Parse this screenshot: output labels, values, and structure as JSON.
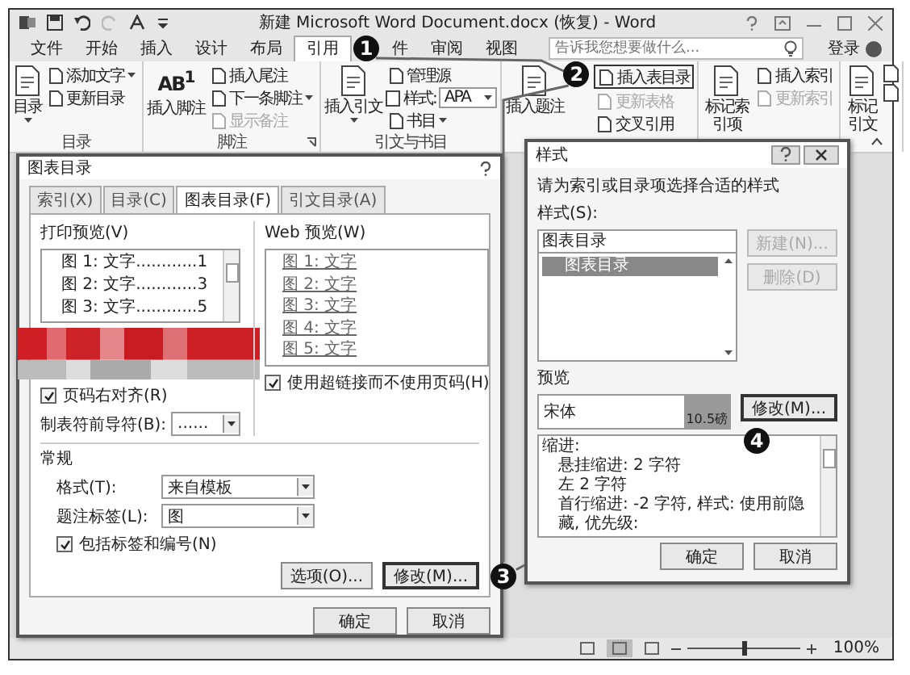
{
  "window": {
    "title": "新建 Microsoft Word Document.docx (恢复) - Word"
  },
  "menu_tabs": [
    {
      "label": "文件",
      "selected": false
    },
    {
      "label": "开始",
      "selected": false
    },
    {
      "label": "插入",
      "selected": false
    },
    {
      "label": "设计",
      "selected": false
    },
    {
      "label": "布局",
      "selected": false
    },
    {
      "label": "引用",
      "selected": true
    },
    {
      "label": "件",
      "selected": false
    },
    {
      "label": "审阅",
      "selected": false
    },
    {
      "label": "视图",
      "selected": false
    }
  ],
  "search": {
    "placeholder": "告诉我您想要做什么..."
  },
  "account": {
    "label": "登录"
  },
  "ribbon": [
    {
      "label": "目录",
      "launcher": false,
      "items": [
        {
          "kind": "large",
          "label": "目录",
          "dropdown": true,
          "disabled": false
        },
        {
          "kind": "small",
          "label": "添加文字",
          "dropdown": true,
          "disabled": false,
          "highlighted": false
        },
        {
          "kind": "small",
          "label": "更新目录",
          "dropdown": false,
          "disabled": false,
          "highlighted": false
        }
      ]
    },
    {
      "label": "脚注",
      "launcher": true,
      "items": [
        {
          "kind": "large",
          "label": "插入脚注",
          "icon_text": "AB$^{1}$",
          "dropdown": false,
          "disabled": false
        },
        {
          "kind": "small",
          "label": "插入尾注",
          "dropdown": false,
          "disabled": false,
          "highlighted": false
        },
        {
          "kind": "small",
          "label": "下一条脚注",
          "dropdown": true,
          "disabled": false,
          "highlighted": false
        },
        {
          "kind": "small",
          "label": "显示备注",
          "dropdown": false,
          "disabled": true,
          "highlighted": false
        }
      ]
    },
    {
      "label": "引文与书目",
      "launcher": false,
      "items": [
        {
          "kind": "large",
          "label": "插入引文",
          "dropdown": true,
          "disabled": false
        },
        {
          "kind": "small",
          "label": "管理源",
          "dropdown": false,
          "disabled": false,
          "highlighted": false
        },
        {
          "kind": "combo",
          "label": "样式:",
          "value": "APA"
        },
        {
          "kind": "small",
          "label": "书目",
          "dropdown": true,
          "disabled": false,
          "highlighted": false
        }
      ]
    },
    {
      "launcher": false,
      "items": [
        {
          "kind": "large",
          "label": "插入题注",
          "dropdown": false,
          "disabled": false
        },
        {
          "kind": "small",
          "label": "插入表目录",
          "dropdown": false,
          "disabled": false,
          "highlighted": true
        },
        {
          "kind": "small",
          "label": "更新表格",
          "dropdown": false,
          "disabled": true,
          "highlighted": false
        },
        {
          "kind": "small",
          "label": "交叉引用",
          "dropdown": false,
          "disabled": false,
          "highlighted": false
        }
      ]
    },
    {
      "launcher": false,
      "items": [
        {
          "kind": "large",
          "label": "标记索引项",
          "dropdown": false,
          "disabled": false
        },
        {
          "kind": "small",
          "label": "插入索引",
          "dropdown": false,
          "disabled": false,
          "highlighted": false
        },
        {
          "kind": "small",
          "label": "更新索引",
          "dropdown": false,
          "disabled": true,
          "highlighted": false
        }
      ]
    },
    {
      "launcher": false,
      "items": [
        {
          "kind": "large",
          "label": "标记引文",
          "dropdown": false,
          "disabled": false
        },
        {
          "kind": "icon"
        },
        {
          "kind": "icon"
        }
      ]
    }
  ],
  "toc_dialog": {
    "title": "图表目录",
    "tabs": [
      {
        "label": "索引(X)",
        "selected": false
      },
      {
        "label": "目录(C)",
        "selected": false
      },
      {
        "label": "图表目录(F)",
        "selected": true
      },
      {
        "label": "引文目录(A)",
        "selected": false
      }
    ],
    "print_preview": {
      "label": "打印预览(V)",
      "entries": [
        "图 1: 文字............1",
        "图 2: 文字............3",
        "图 3: 文字............5"
      ]
    },
    "right_align": {
      "label": "页码右对齐(R)",
      "checked": true
    },
    "tab_leader": {
      "label": "制表符前导符(B):",
      "value": "......"
    },
    "web_preview": {
      "label": "Web 预览(W)",
      "entries": [
        "图 1: 文字",
        "图 2: 文字",
        "图 3: 文字",
        "图 4: 文字",
        "图 5: 文字"
      ]
    },
    "use_hyperlinks": {
      "label": "使用超链接而不使用页码(H)",
      "checked": true
    },
    "general": {
      "label": "常规",
      "format": {
        "label": "格式(T):",
        "value": "来自模板"
      },
      "caption_label": {
        "label": "题注标签(L):",
        "value": "图"
      },
      "include_label": {
        "label": "包括标签和编号(N)",
        "checked": true
      }
    },
    "options_button": "选项(O)...",
    "modify_button": "修改(M)...",
    "buttons": [
      "确定",
      "取消"
    ]
  },
  "style_dialog": {
    "title": "样式",
    "prompt": "请为索引或目录项选择合适的样式",
    "styles_label": "样式(S):",
    "style_name": "图表目录",
    "styles": [
      {
        "label": "图表目录",
        "selected": true
      }
    ],
    "new_button": {
      "label": "新建(N)...",
      "disabled": true
    },
    "delete_button": {
      "label": "删除(D)",
      "disabled": true
    },
    "preview_label": "预览",
    "preview": {
      "font": "宋体",
      "size": "10.5磅"
    },
    "modify_button": "修改(M)...",
    "description": [
      "缩进:",
      "悬挂缩进: 2 字符",
      "左 2 字符",
      "首行缩进: -2 字符, 样式: 使用前隐藏, 优先级:"
    ],
    "buttons": [
      "确定",
      "取消"
    ]
  },
  "callouts": [
    "1",
    "2",
    "3",
    "4"
  ],
  "views": [
    {
      "selected": false
    },
    {
      "selected": true
    },
    {
      "selected": false
    }
  ],
  "zoom": {
    "level": 0.5,
    "reading": "100%"
  }
}
